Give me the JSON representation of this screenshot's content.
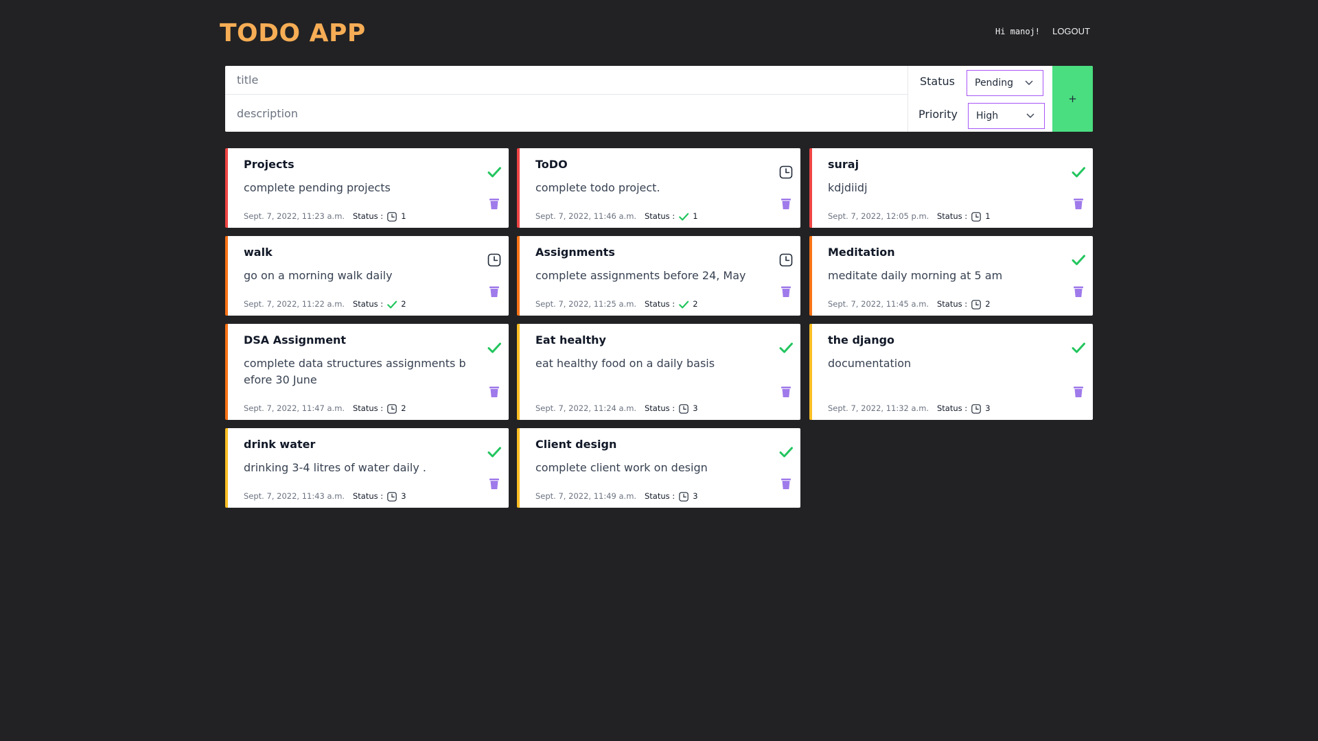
{
  "header": {
    "title": "TODO APP",
    "greeting": "Hi manoj!",
    "logout_label": "LOGOUT"
  },
  "form": {
    "title_placeholder": "title",
    "description_placeholder": "description",
    "status_label": "Status",
    "status_value": "Pending",
    "priority_label": "Priority",
    "priority_value": "High",
    "add_label": "+"
  },
  "colors": {
    "accent": "#f6ad55",
    "high": "#ef4444",
    "medium": "#f97316",
    "low": "#fbbf24",
    "done": "#22c55e",
    "trash": "#9f7aea",
    "add": "#4ade80"
  },
  "status_label": "Status :",
  "todos": [
    {
      "title": "Projects",
      "description": "complete pending projects",
      "date": "Sept. 7, 2022, 11:23 a.m.",
      "toggle_icon": "check-icon",
      "status_icon": "clock-icon",
      "priority": "1"
    },
    {
      "title": "ToDO",
      "description": "complete todo project.",
      "date": "Sept. 7, 2022, 11:46 a.m.",
      "toggle_icon": "clock-icon",
      "status_icon": "check-icon",
      "priority": "1"
    },
    {
      "title": "suraj",
      "description": "kdjdiidj",
      "date": "Sept. 7, 2022, 12:05 p.m.",
      "toggle_icon": "check-icon",
      "status_icon": "clock-icon",
      "priority": "1"
    },
    {
      "title": "walk",
      "description": "go on a morning walk daily",
      "date": "Sept. 7, 2022, 11:22 a.m.",
      "toggle_icon": "clock-icon",
      "status_icon": "check-icon",
      "priority": "2"
    },
    {
      "title": "Assignments",
      "description": "complete assignments before 24, May",
      "date": "Sept. 7, 2022, 11:25 a.m.",
      "toggle_icon": "clock-icon",
      "status_icon": "check-icon",
      "priority": "2"
    },
    {
      "title": "Meditation",
      "description": "meditate daily morning at 5 am",
      "date": "Sept. 7, 2022, 11:45 a.m.",
      "toggle_icon": "check-icon",
      "status_icon": "clock-icon",
      "priority": "2"
    },
    {
      "title": "DSA Assignment",
      "description": "complete data structures assignments before 30 June",
      "date": "Sept. 7, 2022, 11:47 a.m.",
      "toggle_icon": "check-icon",
      "status_icon": "clock-icon",
      "priority": "2"
    },
    {
      "title": "Eat healthy",
      "description": "eat healthy food on a daily basis",
      "date": "Sept. 7, 2022, 11:24 a.m.",
      "toggle_icon": "check-icon",
      "status_icon": "clock-icon",
      "priority": "3"
    },
    {
      "title": "the django",
      "description": "documentation",
      "date": "Sept. 7, 2022, 11:32 a.m.",
      "toggle_icon": "check-icon",
      "status_icon": "clock-icon",
      "priority": "3"
    },
    {
      "title": "drink water",
      "description": "drinking 3-4 litres of water daily .",
      "date": "Sept. 7, 2022, 11:43 a.m.",
      "toggle_icon": "check-icon",
      "status_icon": "clock-icon",
      "priority": "3"
    },
    {
      "title": "Client design",
      "description": "complete client work on design",
      "date": "Sept. 7, 2022, 11:49 a.m.",
      "toggle_icon": "check-icon",
      "status_icon": "clock-icon",
      "priority": "3"
    }
  ]
}
